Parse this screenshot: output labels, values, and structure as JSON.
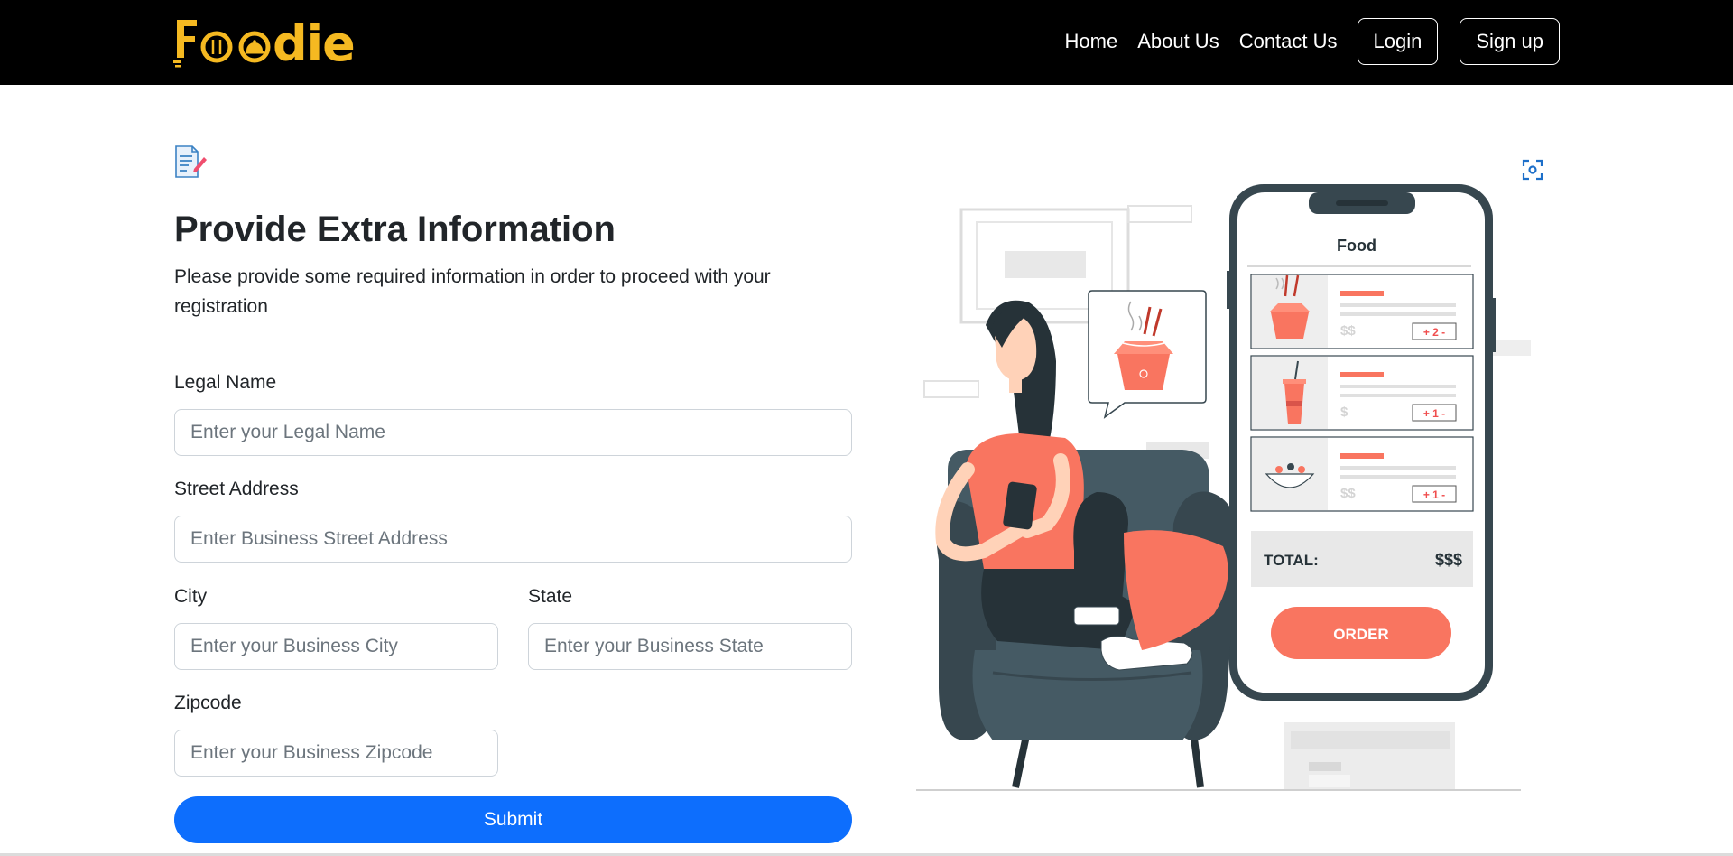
{
  "brand": {
    "name": "Foodie",
    "color": "#f5b921"
  },
  "nav": {
    "links": [
      "Home",
      "About Us",
      "Contact Us"
    ],
    "login_label": "Login",
    "signup_label": "Sign up"
  },
  "form": {
    "title": "Provide Extra Information",
    "subtitle": "Please provide some required information in order to proceed with your registration",
    "fields": {
      "legal_name": {
        "label": "Legal Name",
        "placeholder": "Enter your Legal Name",
        "value": ""
      },
      "street": {
        "label": "Street Address",
        "placeholder": "Enter Business Street Address",
        "value": ""
      },
      "city": {
        "label": "City",
        "placeholder": "Enter your Business City",
        "value": ""
      },
      "state": {
        "label": "State",
        "placeholder": "Enter your Business State",
        "value": ""
      },
      "zipcode": {
        "label": "Zipcode",
        "placeholder": "Enter your Business Zipcode",
        "value": ""
      }
    },
    "submit_label": "Submit"
  },
  "illustration": {
    "phone_header": "Food",
    "items": [
      {
        "price": "$$",
        "qty": "+ 2 -"
      },
      {
        "price": "$",
        "qty": "+ 1 -"
      },
      {
        "price": "$$",
        "qty": "+ 1 -"
      }
    ],
    "total_label": "TOTAL:",
    "total_value": "$$$",
    "order_label": "ORDER",
    "accent": "#f97560",
    "dark": "#37474f"
  },
  "colors": {
    "primary": "#0d6efd",
    "navbar": "#000000"
  }
}
